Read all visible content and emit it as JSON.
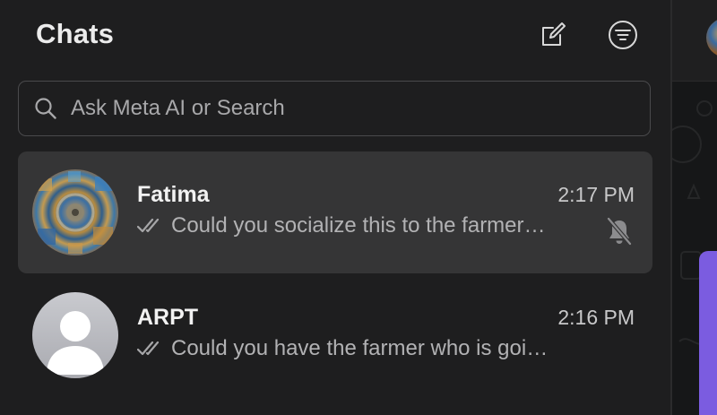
{
  "header": {
    "title": "Chats"
  },
  "icons": {
    "compose": "compose-icon",
    "filter": "filter-icon",
    "search": "search-icon",
    "read_ticks": "double-check-icon",
    "mute": "bell-slash-icon"
  },
  "search": {
    "placeholder": "Ask Meta AI or Search"
  },
  "chats": [
    {
      "name": "Fatima",
      "time": "2:17 PM",
      "preview": "Could you socialize this to the farmer…",
      "muted": true,
      "selected": true
    },
    {
      "name": "ARPT",
      "time": "2:16 PM",
      "preview": "Could you have the farmer who is goi…",
      "muted": false,
      "selected": false
    }
  ],
  "colors": {
    "background": "#1e1e1f",
    "selected_row": "#353536",
    "accent_purple": "#7b5ce0"
  }
}
